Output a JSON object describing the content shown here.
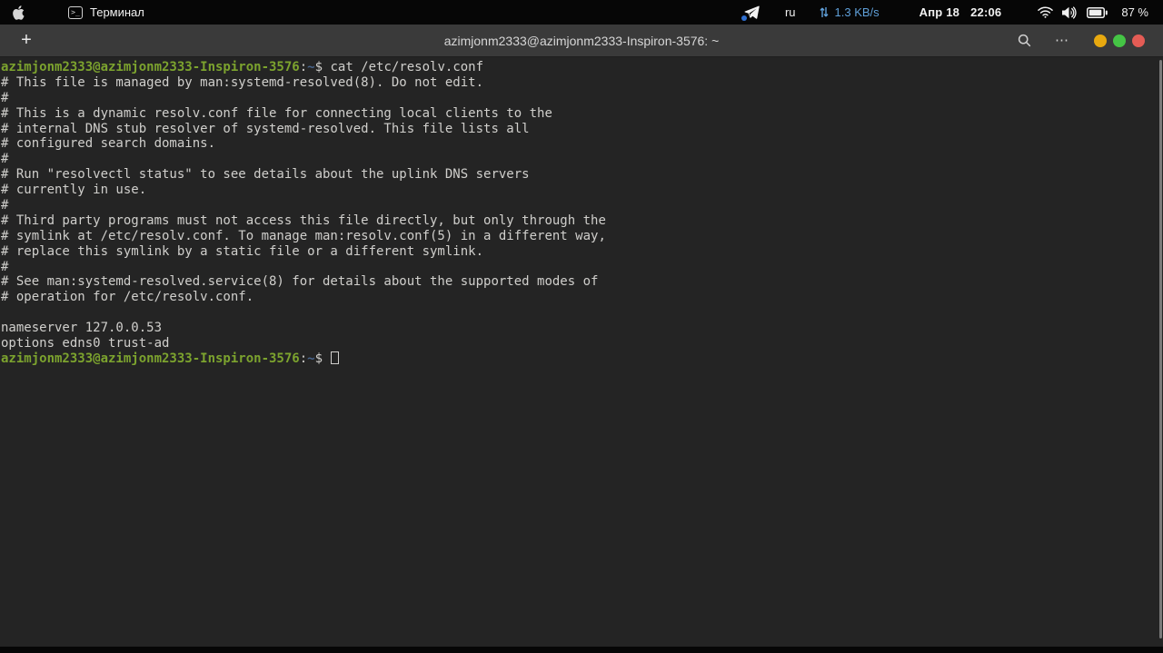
{
  "colors": {
    "topbar_bg": "#060606",
    "headerbar_bg": "#3a3a3a",
    "terminal_bg": "#242424",
    "terminal_fg": "#d0cfcc",
    "prompt_green": "#7ca32e",
    "path_blue": "#48648c",
    "net_speed_blue": "#5f9fd8",
    "btn_minimize": "#e8a90f",
    "btn_maximize": "#45c545",
    "btn_close": "#e45c55"
  },
  "topbar": {
    "apple_menu_icon": "apple-logo-icon",
    "app_menu": {
      "icon": "terminal-app-icon",
      "icon_glyph": ">_",
      "label": "Терминал"
    },
    "tray": {
      "telegram_icon": "telegram-icon",
      "keyboard_layout": "ru",
      "net_arrows_icon": "network-traffic-icon",
      "net_speed": "1.3 KB/s",
      "date": "Апр 18",
      "time": "22:06",
      "wifi_icon": "wifi-icon",
      "volume_icon": "volume-icon",
      "battery_icon": "battery-icon",
      "battery_percent": "87 %"
    }
  },
  "headerbar": {
    "new_tab_label": "+",
    "title": "azimjonm2333@azimjonm2333-Inspiron-3576: ~",
    "search_icon": "search-icon",
    "menu_label": "⋯"
  },
  "terminal": {
    "prompt_user_host": "azimjonm2333@azimjonm2333-Inspiron-3576",
    "command": "cat /etc/resolv.conf",
    "lines": [
      {
        "segments": [
          {
            "t": "azimjonm2333@azimjonm2333-Inspiron-3576",
            "c": "prompt"
          },
          {
            "t": ":",
            "c": "fg"
          },
          {
            "t": "~",
            "c": "path"
          },
          {
            "t": "$ cat /etc/resolv.conf",
            "c": "fg"
          }
        ]
      },
      {
        "segments": [
          {
            "t": "# This file is managed by man:systemd-resolved(8). Do not edit.",
            "c": "fg"
          }
        ]
      },
      {
        "segments": [
          {
            "t": "#",
            "c": "fg"
          }
        ]
      },
      {
        "segments": [
          {
            "t": "# This is a dynamic resolv.conf file for connecting local clients to the",
            "c": "fg"
          }
        ]
      },
      {
        "segments": [
          {
            "t": "# internal DNS stub resolver of systemd-resolved. This file lists all",
            "c": "fg"
          }
        ]
      },
      {
        "segments": [
          {
            "t": "# configured search domains.",
            "c": "fg"
          }
        ]
      },
      {
        "segments": [
          {
            "t": "#",
            "c": "fg"
          }
        ]
      },
      {
        "segments": [
          {
            "t": "# Run \"resolvectl status\" to see details about the uplink DNS servers",
            "c": "fg"
          }
        ]
      },
      {
        "segments": [
          {
            "t": "# currently in use.",
            "c": "fg"
          }
        ]
      },
      {
        "segments": [
          {
            "t": "#",
            "c": "fg"
          }
        ]
      },
      {
        "segments": [
          {
            "t": "# Third party programs must not access this file directly, but only through the",
            "c": "fg"
          }
        ]
      },
      {
        "segments": [
          {
            "t": "# symlink at /etc/resolv.conf. To manage man:resolv.conf(5) in a different way,",
            "c": "fg"
          }
        ]
      },
      {
        "segments": [
          {
            "t": "# replace this symlink by a static file or a different symlink.",
            "c": "fg"
          }
        ]
      },
      {
        "segments": [
          {
            "t": "#",
            "c": "fg"
          }
        ]
      },
      {
        "segments": [
          {
            "t": "# See man:systemd-resolved.service(8) for details about the supported modes of",
            "c": "fg"
          }
        ]
      },
      {
        "segments": [
          {
            "t": "# operation for /etc/resolv.conf.",
            "c": "fg"
          }
        ]
      },
      {
        "segments": []
      },
      {
        "segments": [
          {
            "t": "nameserver 127.0.0.53",
            "c": "fg"
          }
        ]
      },
      {
        "segments": [
          {
            "t": "options edns0 trust-ad",
            "c": "fg"
          }
        ]
      },
      {
        "segments": [
          {
            "t": "azimjonm2333@azimjonm2333-Inspiron-3576",
            "c": "prompt"
          },
          {
            "t": ":",
            "c": "fg"
          },
          {
            "t": "~",
            "c": "path"
          },
          {
            "t": "$ ",
            "c": "fg"
          }
        ],
        "cursor": true
      }
    ]
  }
}
